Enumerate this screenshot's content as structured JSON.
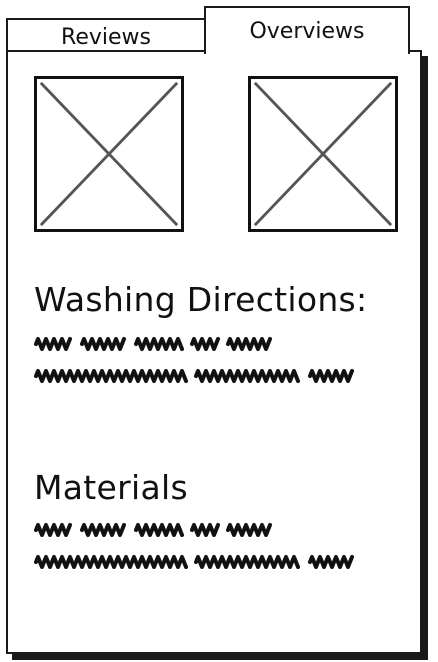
{
  "tabs": [
    {
      "label": "Reviews",
      "active": false
    },
    {
      "label": "Overviews",
      "active": true
    }
  ],
  "overview": {
    "images": [
      {
        "icon": "image-placeholder-icon"
      },
      {
        "icon": "image-placeholder-icon"
      }
    ],
    "sections": [
      {
        "heading": "Washing Directions:",
        "lines": 2
      },
      {
        "heading": "Materials",
        "lines": 2
      }
    ]
  },
  "colors": {
    "ink": "#1a1a1a",
    "placeholder_x": "#555555",
    "background": "#ffffff"
  }
}
